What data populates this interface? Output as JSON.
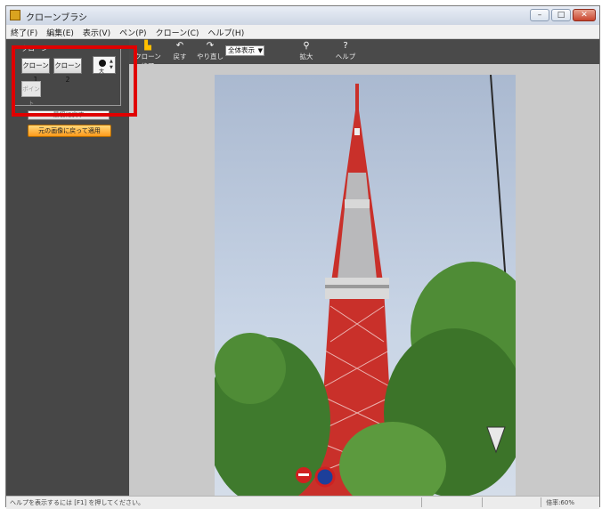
{
  "window": {
    "title": "クローンブラシ"
  },
  "menu": [
    "終了(F)",
    "編集(E)",
    "表示(V)",
    "ペン(P)",
    "クローン(C)",
    "ヘルプ(H)"
  ],
  "toolbar": {
    "clone_end": "クローン終了",
    "undo": "戻す",
    "redo": "やり直し",
    "view_select": "全体表示",
    "zoom": "拡大",
    "help": "ヘルプ"
  },
  "clone_panel": {
    "group_label": "クローン",
    "clone1": "クローン1",
    "clone2": "クローン2",
    "brush_size_label": "大",
    "spot_button": "ポイント",
    "reset_button": "最初に戻す",
    "apply_button": "元の画像に戻って適用"
  },
  "status": {
    "message": "ヘルプを表示するには [F1] を押してください。",
    "zoom": "倍率:60%"
  },
  "colors": {
    "highlight": "#e00000",
    "panel": "#474747",
    "tower_red": "#d8322a"
  }
}
